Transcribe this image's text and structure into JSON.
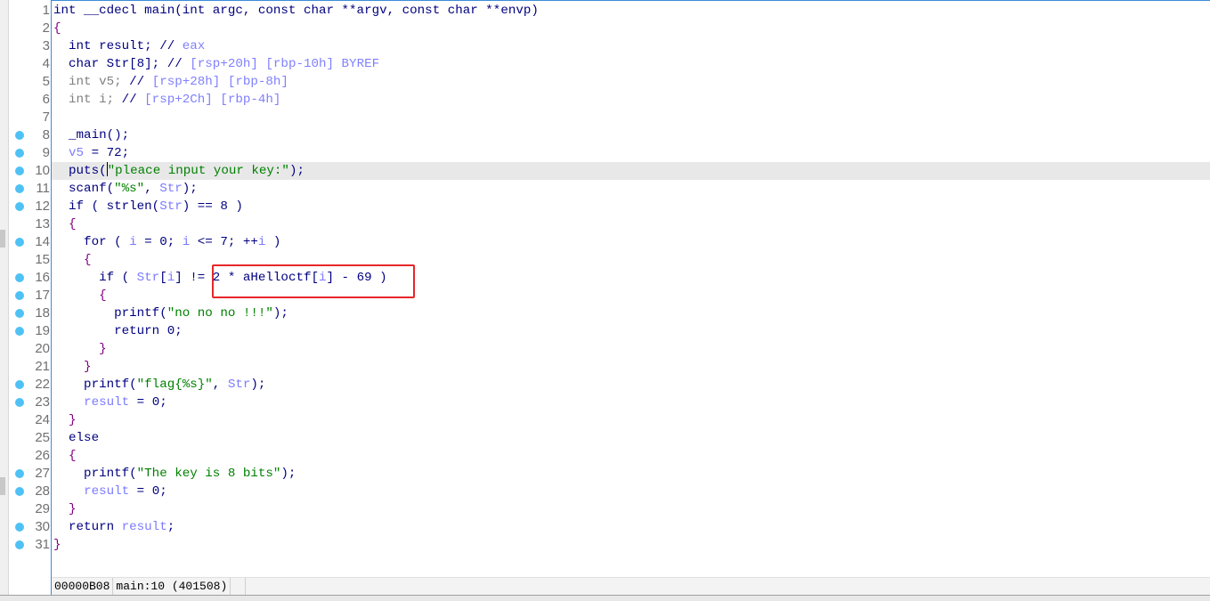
{
  "current_line": 10,
  "breakpoint_lines": [
    8,
    9,
    10,
    11,
    12,
    14,
    16,
    17,
    18,
    19,
    22,
    23,
    27,
    28,
    30,
    31
  ],
  "highlight_box_color": "#e8262a",
  "lines": [
    [
      [
        "int __cdecl main(int argc, const char **argv, const char **envp)",
        "k"
      ]
    ],
    [
      [
        "{",
        "p"
      ]
    ],
    [
      [
        "  int result; ",
        "k"
      ],
      [
        "// ",
        "k"
      ],
      [
        "eax",
        "c"
      ]
    ],
    [
      [
        "  char Str[8]; ",
        "k"
      ],
      [
        "// ",
        "k"
      ],
      [
        "[rsp+20h] [rbp-10h] BYREF",
        "c"
      ]
    ],
    [
      [
        "  int v5; ",
        "g"
      ],
      [
        "// ",
        "k"
      ],
      [
        "[rsp+28h] [rbp-8h]",
        "c"
      ]
    ],
    [
      [
        "  int i; ",
        "g"
      ],
      [
        "// ",
        "k"
      ],
      [
        "[rsp+2Ch] [rbp-4h]",
        "c"
      ]
    ],
    [],
    [
      [
        "  _main();",
        "k"
      ]
    ],
    [
      [
        "  ",
        "k"
      ],
      [
        "v5",
        "v"
      ],
      [
        " = 72;",
        "k"
      ]
    ],
    [
      [
        "  puts(",
        "k"
      ],
      [
        "|caret",
        "caret"
      ],
      [
        "\"pleace input your key:\"",
        "s"
      ],
      [
        ");",
        "k"
      ]
    ],
    [
      [
        "  scanf(",
        "k"
      ],
      [
        "\"%s\"",
        "s"
      ],
      [
        ", ",
        "k"
      ],
      [
        "Str",
        "v"
      ],
      [
        ");",
        "k"
      ]
    ],
    [
      [
        "  if ( strlen(",
        "k"
      ],
      [
        "Str",
        "v"
      ],
      [
        ") == 8 )",
        "k"
      ]
    ],
    [
      [
        "  {",
        "p"
      ]
    ],
    [
      [
        "    for ( ",
        "k"
      ],
      [
        "i",
        "v"
      ],
      [
        " = 0; ",
        "k"
      ],
      [
        "i",
        "v"
      ],
      [
        " <= 7; ++",
        "k"
      ],
      [
        "i",
        "v"
      ],
      [
        " )",
        "k"
      ]
    ],
    [
      [
        "    {",
        "p"
      ]
    ],
    [
      [
        "      if ( ",
        "k"
      ],
      [
        "Str",
        "v"
      ],
      [
        "[",
        "k"
      ],
      [
        "i",
        "v"
      ],
      [
        "] != 2 * aHelloctf[",
        "k"
      ],
      [
        "i",
        "v"
      ],
      [
        "] - 69 )",
        "k"
      ]
    ],
    [
      [
        "      {",
        "p"
      ]
    ],
    [
      [
        "        printf(",
        "k"
      ],
      [
        "\"no no no !!!\"",
        "s"
      ],
      [
        ");",
        "k"
      ]
    ],
    [
      [
        "        return 0;",
        "k"
      ]
    ],
    [
      [
        "      }",
        "p"
      ]
    ],
    [
      [
        "    }",
        "p"
      ]
    ],
    [
      [
        "    printf(",
        "k"
      ],
      [
        "\"flag{%s}\"",
        "s"
      ],
      [
        ", ",
        "k"
      ],
      [
        "Str",
        "v"
      ],
      [
        ");",
        "k"
      ]
    ],
    [
      [
        "    ",
        "k"
      ],
      [
        "result",
        "v"
      ],
      [
        " = 0;",
        "k"
      ]
    ],
    [
      [
        "  }",
        "p"
      ]
    ],
    [
      [
        "  else",
        "k"
      ]
    ],
    [
      [
        "  {",
        "p"
      ]
    ],
    [
      [
        "    printf(",
        "k"
      ],
      [
        "\"The key is 8 bits\"",
        "s"
      ],
      [
        ");",
        "k"
      ]
    ],
    [
      [
        "    ",
        "k"
      ],
      [
        "result",
        "v"
      ],
      [
        " = 0;",
        "k"
      ]
    ],
    [
      [
        "  }",
        "p"
      ]
    ],
    [
      [
        "  return ",
        "k"
      ],
      [
        "result",
        "v"
      ],
      [
        ";",
        "k"
      ]
    ],
    [
      [
        "}",
        "p"
      ]
    ]
  ],
  "status": {
    "offset": "00000B08",
    "location": "main:10 (401508)"
  }
}
